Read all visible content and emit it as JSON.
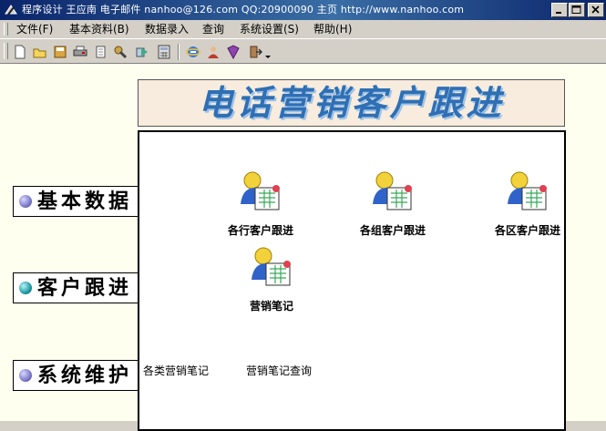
{
  "window": {
    "title": "程序设计 王应南 电子邮件 nanhoo@126.com  QQ:20900090 主页 http://www.nanhoo.com"
  },
  "menu": [
    {
      "label": "文件(F)",
      "name": "menu-file"
    },
    {
      "label": "基本资料(B)",
      "name": "menu-basic-data"
    },
    {
      "label": "数据录入",
      "name": "menu-data-entry"
    },
    {
      "label": "查询",
      "name": "menu-query"
    },
    {
      "label": "系统设置(S)",
      "name": "menu-system-settings"
    },
    {
      "label": "帮助(H)",
      "name": "menu-help"
    }
  ],
  "banner": {
    "title": "电话营销客户跟进"
  },
  "nav": [
    {
      "label": "基本数据",
      "dot_color": "#7b79c9"
    },
    {
      "label": "客户跟进",
      "dot_color": "#1e9aa6"
    },
    {
      "label": "系统维护",
      "dot_color": "#7b79c9"
    }
  ],
  "tiles": [
    {
      "label": "各行客户跟进"
    },
    {
      "label": "各组客户跟进"
    },
    {
      "label": "各区客户跟进"
    },
    {
      "label": "营销笔记"
    }
  ],
  "links": [
    {
      "label": "各类营销笔记"
    },
    {
      "label": "营销笔记查询"
    }
  ],
  "colors": {
    "title_bar": "#0a246a",
    "banner_text": "#2f6fb4",
    "banner_bg": "#f7ecdd",
    "client_bg": "#fffff0"
  },
  "toolbar_icons": [
    "new-icon",
    "open-icon",
    "save-icon",
    "print-icon",
    "copy-icon",
    "tools-icon",
    "export-icon",
    "calculator-icon",
    "ie-icon",
    "user-icon",
    "book-icon",
    "exit-icon"
  ]
}
